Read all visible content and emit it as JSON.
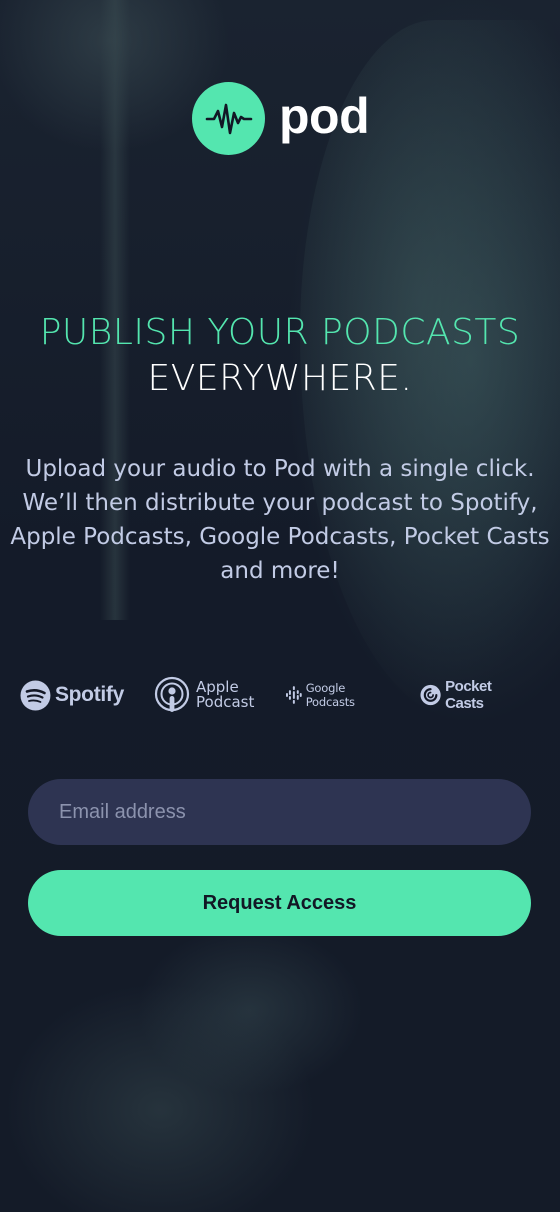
{
  "brand": {
    "name": "pod",
    "icon": "waveform-icon",
    "accent_color": "#54E6AF"
  },
  "headline": {
    "accent_line": "PUBLISH YOUR PODCASTS",
    "white_line": "EVERYWHERE."
  },
  "intro": "Upload your audio to Pod with a single click. We’ll then distribute your podcast to Spotify, Apple Podcasts, Google Podcasts, Pocket Casts and more!",
  "platforms": {
    "spotify": "Spotify",
    "apple_line1": "Apple",
    "apple_line2": "Podcast",
    "google": "Google Podcasts",
    "pocket": "Pocket Casts"
  },
  "form": {
    "email_placeholder": "Email address",
    "submit_label": "Request Access"
  },
  "colors": {
    "background": "#121725",
    "input_background": "#2E3452",
    "text_muted": "#C2CBE5"
  }
}
